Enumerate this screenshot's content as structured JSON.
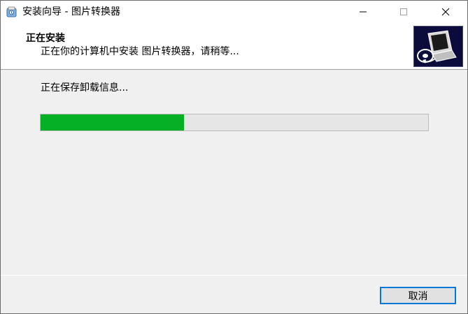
{
  "window": {
    "title": "安装向导 - 图片转换器"
  },
  "header": {
    "title": "正在安装",
    "subtitle": "正在你的计算机中安装 图片转换器，请稍等..."
  },
  "body": {
    "status": "正在保存卸载信息...",
    "progress_fraction": 0.37
  },
  "footer": {
    "cancel_label": "取消"
  },
  "colors": {
    "progress_fill": "#06b025",
    "accent_border": "#0078d7",
    "header_image_bg": "#0c0c3c"
  },
  "icons": {
    "app": "installer-app-icon",
    "minimize": "minimize-icon",
    "maximize": "maximize-icon",
    "close": "close-icon",
    "header_image": "computer-install-icon"
  }
}
